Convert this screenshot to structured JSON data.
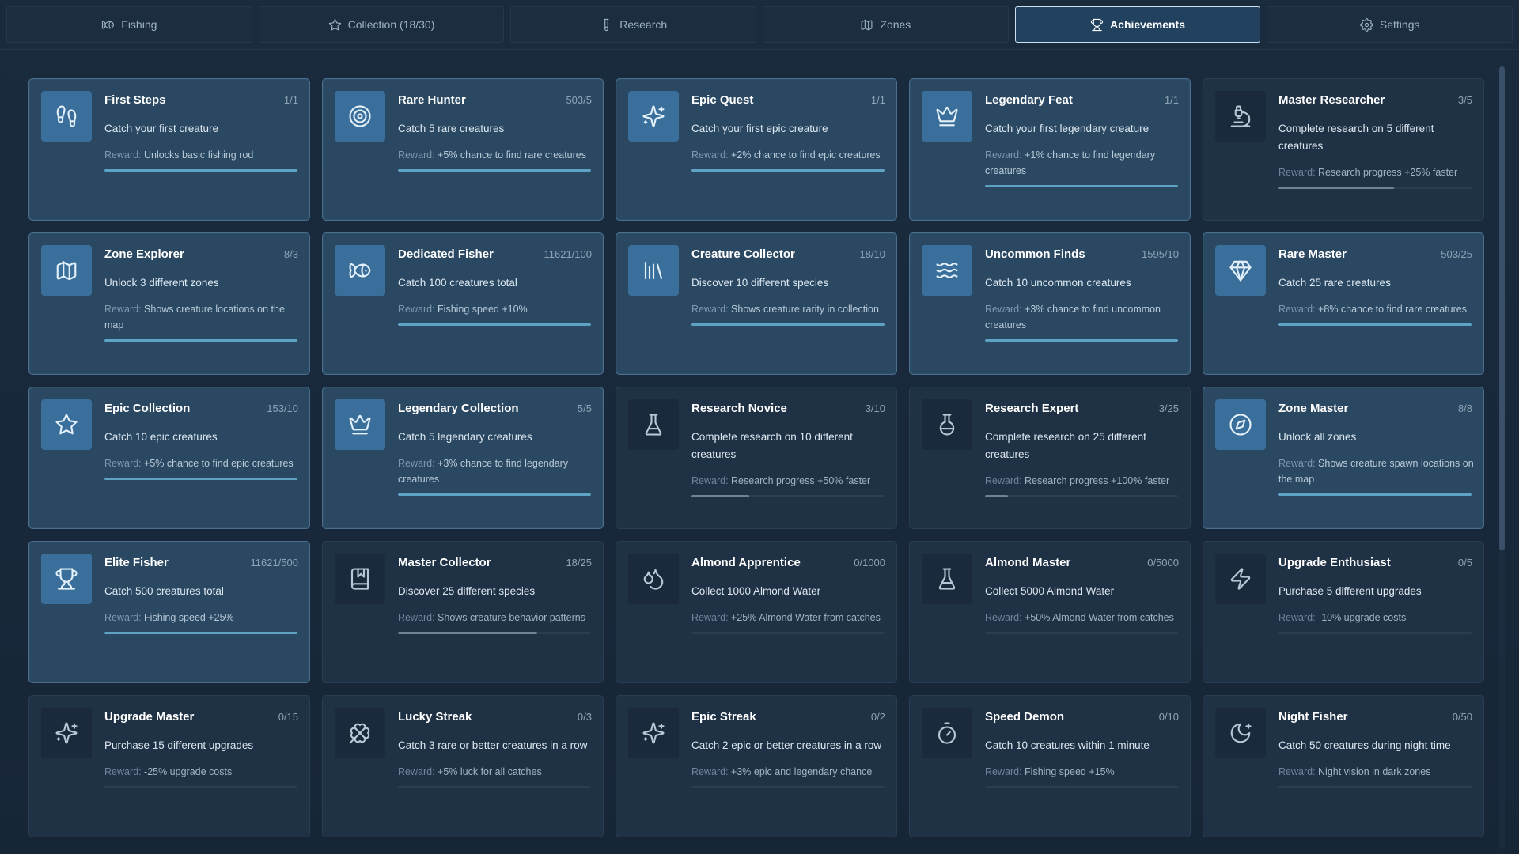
{
  "tabs": [
    {
      "label": "Fishing",
      "icon": "fish-icon",
      "active": false
    },
    {
      "label": "Collection (18/30)",
      "icon": "star-icon",
      "active": false
    },
    {
      "label": "Research",
      "icon": "test-tube-icon",
      "active": false
    },
    {
      "label": "Zones",
      "icon": "map-icon",
      "active": false
    },
    {
      "label": "Achievements",
      "icon": "trophy-icon",
      "active": true
    },
    {
      "label": "Settings",
      "icon": "gear-icon",
      "active": false
    }
  ],
  "reward_label": "Reward:",
  "colors": {
    "accent": "#5fa3c4",
    "completed_card": "#2a4862",
    "locked_card": "#1f3145",
    "active_tab_border": "#cfe0ee"
  },
  "achievements": [
    {
      "title": "First Steps",
      "count": "1/1",
      "description": "Catch your first creature",
      "reward": "Unlocks basic fishing rod",
      "icon": "footprints-icon",
      "completed": true,
      "progress": 1.0
    },
    {
      "title": "Rare Hunter",
      "count": "503/5",
      "description": "Catch 5 rare creatures",
      "reward": "+5% chance to find rare creatures",
      "icon": "target-icon",
      "completed": true,
      "progress": 1.0
    },
    {
      "title": "Epic Quest",
      "count": "1/1",
      "description": "Catch your first epic creature",
      "reward": "+2% chance to find epic creatures",
      "icon": "sparkles-icon",
      "completed": true,
      "progress": 1.0
    },
    {
      "title": "Legendary Feat",
      "count": "1/1",
      "description": "Catch your first legendary creature",
      "reward": "+1% chance to find legendary creatures",
      "icon": "crown-icon",
      "completed": true,
      "progress": 1.0
    },
    {
      "title": "Master Researcher",
      "count": "3/5",
      "description": "Complete research on 5 different creatures",
      "reward": "Research progress +25% faster",
      "icon": "microscope-icon",
      "completed": false,
      "progress": 0.6
    },
    {
      "title": "Zone Explorer",
      "count": "8/3",
      "description": "Unlock 3 different zones",
      "reward": "Shows creature locations on the map",
      "icon": "map-icon",
      "completed": true,
      "progress": 1.0
    },
    {
      "title": "Dedicated Fisher",
      "count": "11621/100",
      "description": "Catch 100 creatures total",
      "reward": "Fishing speed +10%",
      "icon": "fish-icon",
      "completed": true,
      "progress": 1.0
    },
    {
      "title": "Creature Collector",
      "count": "18/10",
      "description": "Discover 10 different species",
      "reward": "Shows creature rarity in collection",
      "icon": "library-icon",
      "completed": true,
      "progress": 1.0
    },
    {
      "title": "Uncommon Finds",
      "count": "1595/10",
      "description": "Catch 10 uncommon creatures",
      "reward": "+3% chance to find uncommon creatures",
      "icon": "waves-icon",
      "completed": true,
      "progress": 1.0
    },
    {
      "title": "Rare Master",
      "count": "503/25",
      "description": "Catch 25 rare creatures",
      "reward": "+8% chance to find rare creatures",
      "icon": "gem-icon",
      "completed": true,
      "progress": 1.0
    },
    {
      "title": "Epic Collection",
      "count": "153/10",
      "description": "Catch 10 epic creatures",
      "reward": "+5% chance to find epic creatures",
      "icon": "star-icon",
      "completed": true,
      "progress": 1.0
    },
    {
      "title": "Legendary Collection",
      "count": "5/5",
      "description": "Catch 5 legendary creatures",
      "reward": "+3% chance to find legendary creatures",
      "icon": "crown-icon",
      "completed": true,
      "progress": 1.0
    },
    {
      "title": "Research Novice",
      "count": "3/10",
      "description": "Complete research on 10 different creatures",
      "reward": "Research progress +50% faster",
      "icon": "flask-icon",
      "completed": false,
      "progress": 0.3
    },
    {
      "title": "Research Expert",
      "count": "3/25",
      "description": "Complete research on 25 different creatures",
      "reward": "Research progress +100% faster",
      "icon": "round-flask-icon",
      "completed": false,
      "progress": 0.12
    },
    {
      "title": "Zone Master",
      "count": "8/8",
      "description": "Unlock all zones",
      "reward": "Shows creature spawn locations on the map",
      "icon": "compass-icon",
      "completed": true,
      "progress": 1.0
    },
    {
      "title": "Elite Fisher",
      "count": "11621/500",
      "description": "Catch 500 creatures total",
      "reward": "Fishing speed +25%",
      "icon": "trophy-icon",
      "completed": true,
      "progress": 1.0
    },
    {
      "title": "Master Collector",
      "count": "18/25",
      "description": "Discover 25 different species",
      "reward": "Shows creature behavior patterns",
      "icon": "bookmark-book-icon",
      "completed": false,
      "progress": 0.72
    },
    {
      "title": "Almond Apprentice",
      "count": "0/1000",
      "description": "Collect 1000 Almond Water",
      "reward": "+25% Almond Water from catches",
      "icon": "droplets-icon",
      "completed": false,
      "progress": 0
    },
    {
      "title": "Almond Master",
      "count": "0/5000",
      "description": "Collect 5000 Almond Water",
      "reward": "+50% Almond Water from catches",
      "icon": "flask-icon",
      "completed": false,
      "progress": 0
    },
    {
      "title": "Upgrade Enthusiast",
      "count": "0/5",
      "description": "Purchase 5 different upgrades",
      "reward": "-10% upgrade costs",
      "icon": "zap-icon",
      "completed": false,
      "progress": 0
    },
    {
      "title": "Upgrade Master",
      "count": "0/15",
      "description": "Purchase 15 different upgrades",
      "reward": "-25% upgrade costs",
      "icon": "sparkles-icon",
      "completed": false,
      "progress": 0
    },
    {
      "title": "Lucky Streak",
      "count": "0/3",
      "description": "Catch 3 rare or better creatures in a row",
      "reward": "+5% luck for all catches",
      "icon": "clover-icon",
      "completed": false,
      "progress": 0
    },
    {
      "title": "Epic Streak",
      "count": "0/2",
      "description": "Catch 2 epic or better creatures in a row",
      "reward": "+3% epic and legendary chance",
      "icon": "sparkles-icon",
      "completed": false,
      "progress": 0
    },
    {
      "title": "Speed Demon",
      "count": "0/10",
      "description": "Catch 10 creatures within 1 minute",
      "reward": "Fishing speed +15%",
      "icon": "timer-icon",
      "completed": false,
      "progress": 0
    },
    {
      "title": "Night Fisher",
      "count": "0/50",
      "description": "Catch 50 creatures during night time",
      "reward": "Night vision in dark zones",
      "icon": "moon-star-icon",
      "completed": false,
      "progress": 0
    }
  ]
}
